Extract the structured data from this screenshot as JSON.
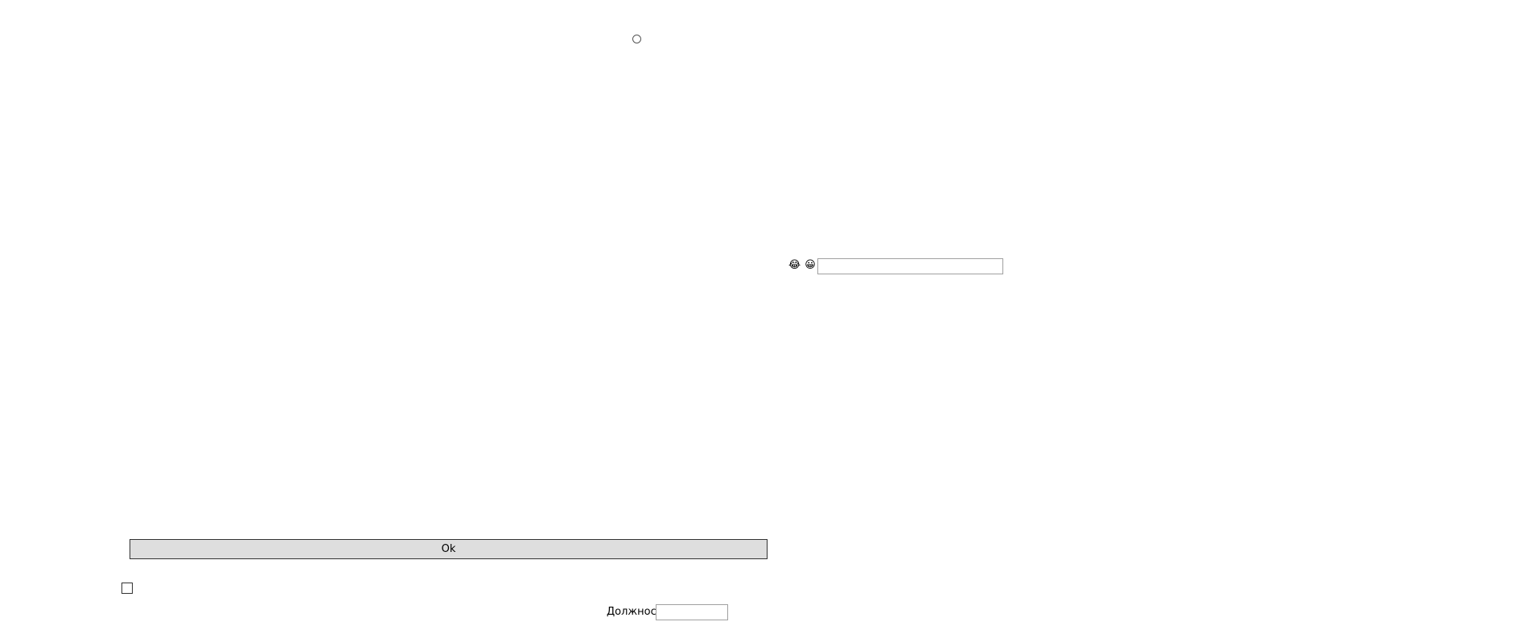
{
  "radio": {
    "checked": false
  },
  "emoji_row": {
    "icons": [
      "laughing-face-icon",
      "grinning-face-icon"
    ],
    "glyphs": [
      "😂",
      "😀"
    ],
    "input_value": ""
  },
  "ok_button": {
    "label": "Ok"
  },
  "checkbox": {
    "checked": false
  },
  "position_field": {
    "label": "Должность",
    "value": ""
  }
}
